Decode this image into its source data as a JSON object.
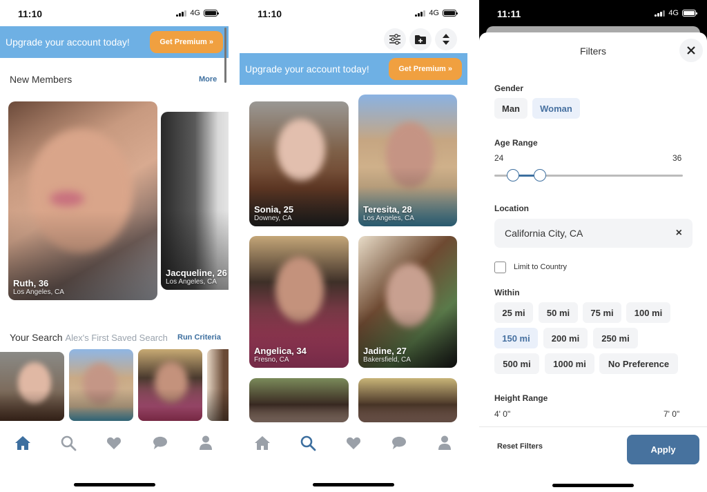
{
  "screens": [
    {
      "status": {
        "time": "11:10",
        "network": "4G"
      },
      "promo": {
        "message": "Upgrade your account today!",
        "button": "Get Premium »"
      },
      "new_members": {
        "title": "New Members",
        "more": "More",
        "cards": [
          {
            "name": "Ruth, 36",
            "location": "Los Angeles, CA"
          },
          {
            "name": "Jacqueline, 26",
            "location": "Los Angeles, CA"
          }
        ]
      },
      "your_search": {
        "title": "Your Search",
        "saved_name": "Alex's First Saved Search",
        "run": "Run Criteria"
      },
      "tabs": [
        {
          "icon": "home-icon",
          "active": true
        },
        {
          "icon": "search-icon",
          "active": false
        },
        {
          "icon": "heart-icon",
          "active": false
        },
        {
          "icon": "chat-icon",
          "active": false
        },
        {
          "icon": "profile-icon",
          "active": false
        }
      ]
    },
    {
      "status": {
        "time": "11:10",
        "network": "4G"
      },
      "toolbar": [
        "filters-icon",
        "save-search-icon",
        "sort-icon"
      ],
      "promo": {
        "message": "Upgrade your account today!",
        "button": "Get Premium »"
      },
      "results": [
        {
          "name": "Sonia, 25",
          "location": "Downey, CA"
        },
        {
          "name": "Teresita, 28",
          "location": "Los Angeles, CA"
        },
        {
          "name": "Angelica, 34",
          "location": "Fresno, CA"
        },
        {
          "name": "Jadine, 27",
          "location": "Bakersfield, CA"
        },
        {
          "name": "",
          "location": ""
        },
        {
          "name": "",
          "location": ""
        }
      ],
      "tabs": [
        {
          "icon": "home-icon",
          "active": false
        },
        {
          "icon": "search-icon",
          "active": true
        },
        {
          "icon": "heart-icon",
          "active": false
        },
        {
          "icon": "chat-icon",
          "active": false
        },
        {
          "icon": "profile-icon",
          "active": false
        }
      ]
    },
    {
      "status": {
        "time": "11:11",
        "network": "4G"
      },
      "filters": {
        "title": "Filters",
        "gender": {
          "label": "Gender",
          "options": [
            "Man",
            "Woman"
          ],
          "selected": "Woman"
        },
        "age": {
          "label": "Age Range",
          "min_label": "24",
          "max_label": "36",
          "low_fraction": 0.1,
          "high_fraction": 0.24
        },
        "location": {
          "label": "Location",
          "value": "California City, CA",
          "clear": "×"
        },
        "limit_country": {
          "label": "Limit to Country",
          "checked": false
        },
        "within": {
          "label": "Within",
          "options": [
            "25 mi",
            "50 mi",
            "75 mi",
            "100 mi",
            "150 mi",
            "200 mi",
            "250 mi",
            "500 mi",
            "1000 mi",
            "No Preference"
          ],
          "selected": "150 mi"
        },
        "height": {
          "label": "Height Range",
          "min_label": "4' 0\"",
          "max_label": "7' 0\""
        },
        "reset": "Reset Filters",
        "apply": "Apply"
      }
    }
  ],
  "colors": {
    "accent": "#3d6f9f",
    "promo_bg": "#6eb0e4",
    "premium": "#f0a040",
    "apply": "#47729e",
    "tab_inactive": "#9aa0a8"
  }
}
